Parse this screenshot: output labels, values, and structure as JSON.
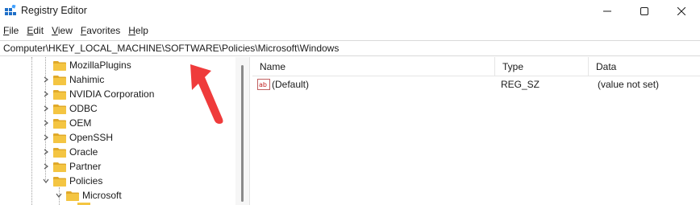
{
  "window": {
    "title": "Registry Editor",
    "controls": {
      "minimize": "minimize",
      "maximize": "maximize",
      "close": "close"
    }
  },
  "menu": {
    "items": [
      {
        "label": "File"
      },
      {
        "label": "Edit"
      },
      {
        "label": "View"
      },
      {
        "label": "Favorites"
      },
      {
        "label": "Help"
      }
    ]
  },
  "address": {
    "path": "Computer\\HKEY_LOCAL_MACHINE\\SOFTWARE\\Policies\\Microsoft\\Windows"
  },
  "tree": {
    "items": [
      {
        "label": "MozillaPlugins",
        "expanded": false,
        "level": 1
      },
      {
        "label": "Nahimic",
        "expanded": false,
        "level": 1
      },
      {
        "label": "NVIDIA Corporation",
        "expanded": false,
        "level": 1
      },
      {
        "label": "ODBC",
        "expanded": false,
        "level": 1
      },
      {
        "label": "OEM",
        "expanded": false,
        "level": 1
      },
      {
        "label": "OpenSSH",
        "expanded": false,
        "level": 1
      },
      {
        "label": "Oracle",
        "expanded": false,
        "level": 1
      },
      {
        "label": "Partner",
        "expanded": false,
        "level": 1
      },
      {
        "label": "Policies",
        "expanded": true,
        "level": 1
      },
      {
        "label": "Microsoft",
        "expanded": true,
        "level": 2
      }
    ]
  },
  "list": {
    "columns": [
      {
        "label": "Name"
      },
      {
        "label": "Type"
      },
      {
        "label": "Data"
      }
    ],
    "rows": [
      {
        "name": "(Default)",
        "type": "REG_SZ",
        "data": "(value not set)",
        "icon": "string-value-icon"
      }
    ]
  },
  "colors": {
    "folder": "#f4c542",
    "folder_dark": "#e0a92a",
    "annotation_arrow": "#ef3b3b",
    "app_icon": "#1f6fc7"
  }
}
